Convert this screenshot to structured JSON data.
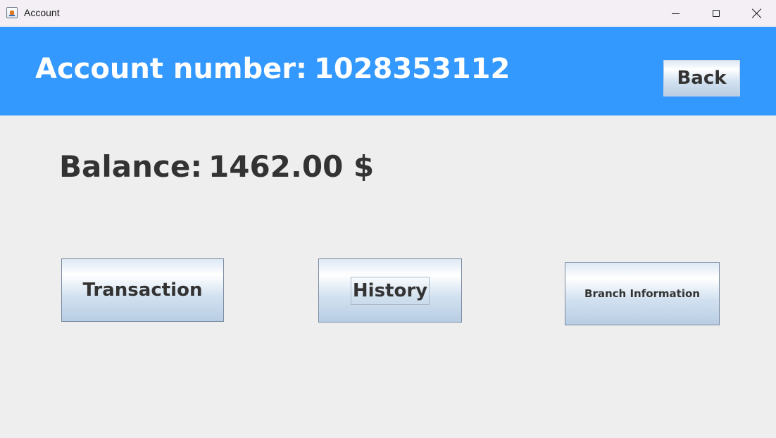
{
  "window": {
    "title": "Account",
    "controls": {
      "minimize": "minimize-icon",
      "maximize": "maximize-icon",
      "close": "close-icon"
    }
  },
  "header": {
    "account_label": "Account number:",
    "account_number": "1028353112",
    "back_label": "Back",
    "background_color": "#3399ff"
  },
  "balance": {
    "label": "Balance:",
    "value": "1462.00 $"
  },
  "actions": {
    "transaction_label": "Transaction",
    "history_label": "History",
    "branch_info_label": "Branch Information"
  },
  "colors": {
    "page_background": "#eeeeee",
    "text": "#333333",
    "header_text": "#ffffff"
  }
}
